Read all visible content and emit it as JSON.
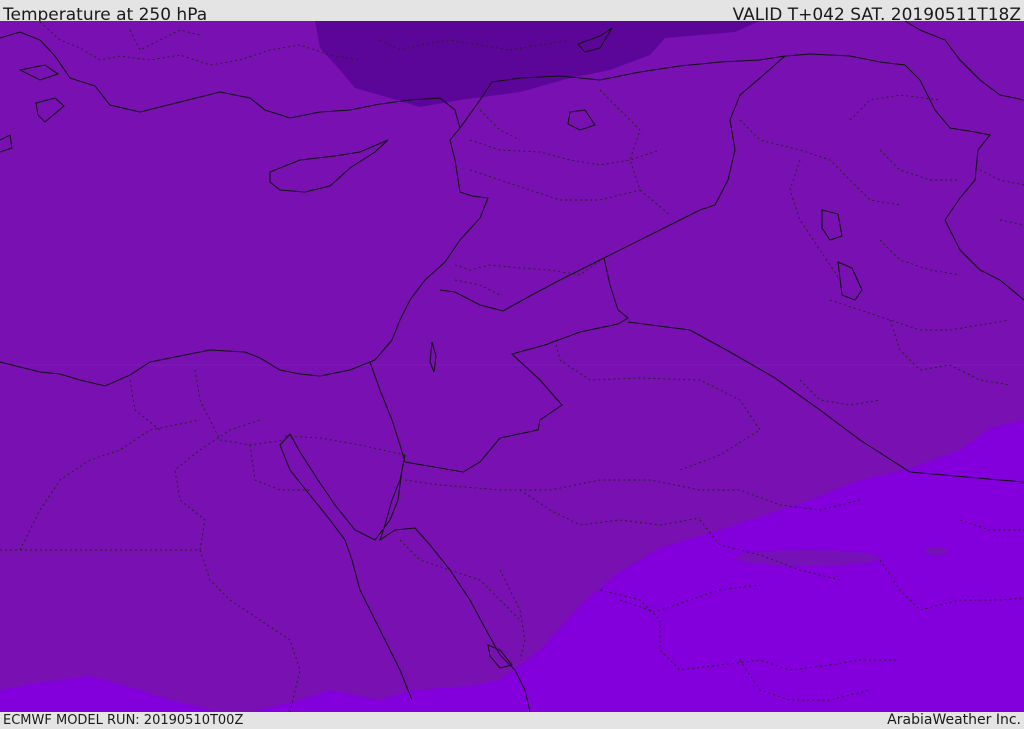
{
  "header": {
    "title": "Temperature at 250 hPa",
    "valid_time": "VALID T+042 SAT. 20190511T18Z"
  },
  "footer": {
    "model_run": "ECMWF MODEL RUN: 20190510T00Z",
    "credit": "ArabiaWeather Inc."
  },
  "map": {
    "region": "Eastern Mediterranean / Middle East",
    "colors": {
      "cold": "#5b0497",
      "base": "#7810b2",
      "mid": "#7a12b8",
      "warm": "#8100da",
      "border": "#111111"
    }
  }
}
